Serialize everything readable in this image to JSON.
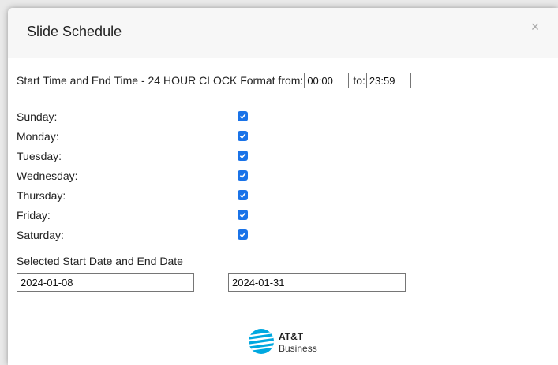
{
  "dialog": {
    "title": "Slide Schedule",
    "close_symbol": "×"
  },
  "time": {
    "label_prefix": "Start Time and End Time - 24 HOUR CLOCK Format from:",
    "from_value": "00:00",
    "to_label": "to:",
    "to_value": "23:59"
  },
  "days": [
    {
      "label": "Sunday:",
      "checked": true
    },
    {
      "label": "Monday:",
      "checked": true
    },
    {
      "label": "Tuesday:",
      "checked": true
    },
    {
      "label": "Wednesday:",
      "checked": true
    },
    {
      "label": "Thursday:",
      "checked": true
    },
    {
      "label": "Friday:",
      "checked": true
    },
    {
      "label": "Saturday:",
      "checked": true
    }
  ],
  "dates": {
    "label": "Selected Start Date and End Date",
    "start_value": "2024-01-08",
    "end_value": "2024-01-31"
  },
  "logo": {
    "line1": "AT&T",
    "line2": "Business"
  },
  "colors": {
    "checkbox_accent": "#1a73e8",
    "logo_blue": "#00a8e0"
  }
}
